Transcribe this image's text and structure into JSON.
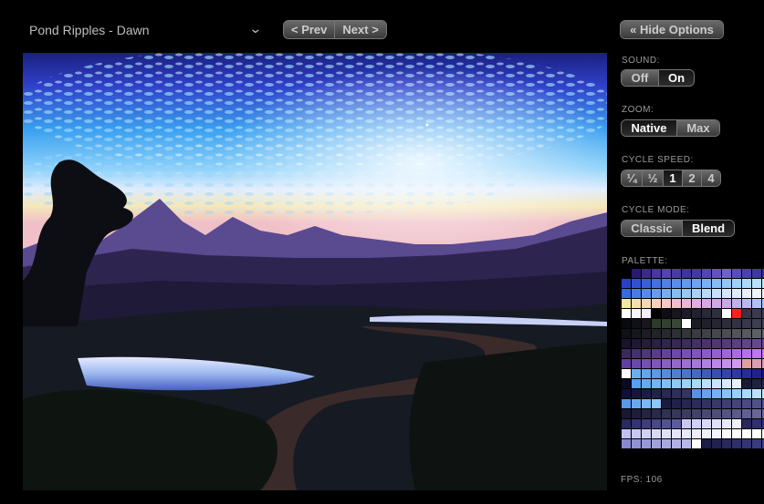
{
  "scene_selector": {
    "value": "Pond Ripples - Dawn"
  },
  "nav": {
    "prev_label": "< Prev",
    "next_label": "Next >"
  },
  "hide_options_label": "« Hide Options",
  "sound": {
    "label": "SOUND:",
    "off": "Off",
    "on": "On",
    "selected": "On"
  },
  "zoom": {
    "label": "ZOOM:",
    "native": "Native",
    "max": "Max",
    "selected": "Native"
  },
  "cycle_speed": {
    "label": "CYCLE SPEED:",
    "options": [
      "¼",
      "½",
      "1",
      "2",
      "4"
    ],
    "selected": "1"
  },
  "cycle_mode": {
    "label": "CYCLE MODE:",
    "classic": "Classic",
    "blend": "Blend",
    "selected": "Blend"
  },
  "palette": {
    "label": "PALETTE:",
    "colors": [
      "#000000",
      "#2a1a6e",
      "#3b2a8a",
      "#4a34a6",
      "#5640b8",
      "#4a3aa8",
      "#3e33a0",
      "#4438a8",
      "#5244b8",
      "#6650c4",
      "#7060cc",
      "#5a4cc0",
      "#4a40b4",
      "#3c38a8",
      "#3630a0",
      "#302a98",
      "#2a40c8",
      "#3052d0",
      "#3a60d8",
      "#4470e0",
      "#5080e6",
      "#5a8cec",
      "#6498f0",
      "#70a4f2",
      "#7cb0f4",
      "#88bcf6",
      "#94c6f8",
      "#a0d0fa",
      "#acd8fc",
      "#b8e0fc",
      "#c4e8fe",
      "#d0eefe",
      "#3a6ae0",
      "#4a7ae4",
      "#5a8ae8",
      "#6a9aec",
      "#7aaaf0",
      "#8abaf2",
      "#9ac6f4",
      "#aad0f6",
      "#bad8f8",
      "#cae0fa",
      "#d6e6fa",
      "#e0ecfc",
      "#e8f0fc",
      "#eef4fe",
      "#f4f8fe",
      "#fafcff",
      "#f0e8a0",
      "#f4e0a8",
      "#f8d8b0",
      "#fad0b8",
      "#f6c8c0",
      "#f0c0c8",
      "#e8b8d0",
      "#e0b0d8",
      "#d8a8e0",
      "#d0a8e4",
      "#c8a8e8",
      "#c0b0ec",
      "#b8b8f0",
      "#b0c0f4",
      "#a8c8f6",
      "#a0d0f8",
      "#ffffff",
      "#f8f4ff",
      "#f4ecff",
      "#000000",
      "#0e0e14",
      "#16161e",
      "#1c1c26",
      "#22222e",
      "#282836",
      "#2e2e3e",
      "#ffffff",
      "#ff2020",
      "#343444",
      "#3a3a4c",
      "#404054",
      "#46465c",
      "#0a0a0e",
      "#101016",
      "#16161c",
      "#2c3a2a",
      "#324030",
      "#384636",
      "#ffffff",
      "#1a1a22",
      "#20202a",
      "#262632",
      "#2c2c3a",
      "#323242",
      "#38384a",
      "#3e3e52",
      "#44445a",
      "#4a4a62",
      "#101018",
      "#16161e",
      "#1c1c24",
      "#22222a",
      "#282830",
      "#2e2e36",
      "#34343c",
      "#3a3a42",
      "#404048",
      "#46464e",
      "#4c4c54",
      "#52525a",
      "#585860",
      "#5e5e66",
      "#64646c",
      "#6a6a72",
      "#18142a",
      "#1e1832",
      "#241c3a",
      "#2a2042",
      "#30244a",
      "#362852",
      "#3c2c5a",
      "#423062",
      "#48346a",
      "#4e3872",
      "#543c7a",
      "#5a4082",
      "#60448a",
      "#664892",
      "#6c4c9a",
      "#7250a2",
      "#3a2a5a",
      "#44306a",
      "#4e367a",
      "#583c8a",
      "#62429a",
      "#6c48aa",
      "#764eb4",
      "#8054be",
      "#8a5ac8",
      "#9460d0",
      "#9e66d8",
      "#a86ce0",
      "#b272e6",
      "#bc78ec",
      "#c67ef2",
      "#d084f6",
      "#6040a0",
      "#6a48a8",
      "#7450b0",
      "#7e58b8",
      "#8860c0",
      "#9268c8",
      "#9c70d0",
      "#a678d8",
      "#b080e0",
      "#ba88e6",
      "#c490ec",
      "#ce98f0",
      "#e0a0a0",
      "#d8a0b0",
      "#d0a0c0",
      "#c8a0d0",
      "#ffffff",
      "#6ab0f0",
      "#64a4e8",
      "#5e98e0",
      "#588cd8",
      "#5280d0",
      "#4c74c8",
      "#4668c0",
      "#405cb8",
      "#3a50b0",
      "#3444a8",
      "#2e38a0",
      "#282c98",
      "#222090",
      "#1c1488",
      "#160880",
      "#0a0a20",
      "#58a0ec",
      "#66aaf0",
      "#74b4f4",
      "#82bef6",
      "#90c8f8",
      "#9ed0fa",
      "#acd8fc",
      "#bae0fc",
      "#c8e6fe",
      "#d6ecfe",
      "#e4f2ff",
      "#1a1a3a",
      "#202044",
      "#26264e",
      "#2c2c58",
      "#101030",
      "#161638",
      "#1c1c40",
      "#222248",
      "#282850",
      "#2e2e58",
      "#343460",
      "#5a90e0",
      "#6aa0e8",
      "#7ab0f0",
      "#8ac0f6",
      "#9acefa",
      "#aad8fc",
      "#bae2fe",
      "#cae8fe",
      "#daf0ff",
      "#5a98e8",
      "#6aa8ee",
      "#7ab8f4",
      "#8ac6f8",
      "#1a1a40",
      "#202048",
      "#262650",
      "#2c2c58",
      "#323260",
      "#383868",
      "#3e3e70",
      "#444478",
      "#4a4a80",
      "#505088",
      "#565690",
      "#5c5c98",
      "#181830",
      "#1e1e38",
      "#242440",
      "#2a2a48",
      "#303050",
      "#363658",
      "#3c3c60",
      "#424268",
      "#484870",
      "#4e4e78",
      "#545480",
      "#5a5a88",
      "#606090",
      "#666698",
      "#6c6ca0",
      "#7272a8",
      "#2a2a60",
      "#34346c",
      "#3e3e78",
      "#484884",
      "#525290",
      "#5c5c9c",
      "#c8c8f0",
      "#d0d0f4",
      "#d8d8f6",
      "#e0e0f8",
      "#e8e8fa",
      "#f0f0fc",
      "#28285a",
      "#30306a",
      "#38387a",
      "#40408a",
      "#c0c0f0",
      "#c8c8f2",
      "#d0d0f4",
      "#d8d8f6",
      "#e0e0f8",
      "#e4e4fa",
      "#e8e8fa",
      "#ececfc",
      "#f0f0fc",
      "#f4f4fe",
      "#f8f8fe",
      "#fcfcff",
      "#ffffff",
      "#ffffff",
      "#ffffff",
      "#ffffff",
      "#8888d0",
      "#9090d4",
      "#9898d8",
      "#a0a0dc",
      "#a8a8e0",
      "#b0b0e4",
      "#b8b8e8",
      "#ffffff",
      "#1c1c44",
      "#222250",
      "#28285c",
      "#2e2e68",
      "#343474",
      "#3a3a80",
      "#40408c",
      "#464698"
    ]
  },
  "fps": {
    "label": "FPS:",
    "value": "106"
  }
}
